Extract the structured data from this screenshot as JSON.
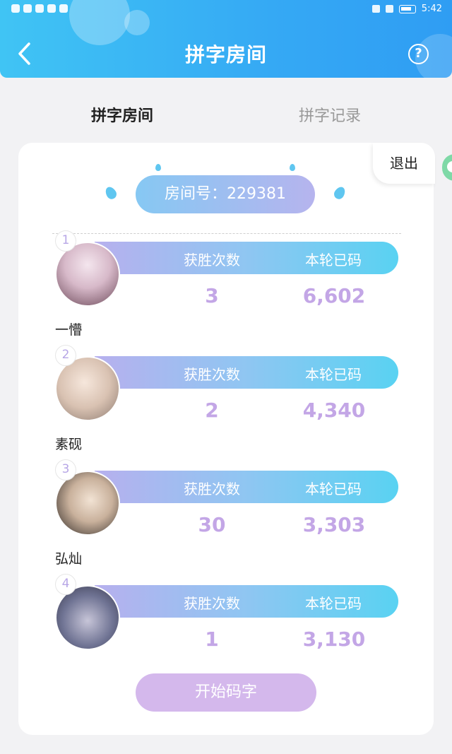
{
  "status_bar": {
    "time": "5:42"
  },
  "header": {
    "title": "拼字房间",
    "back_icon": "chevron-left-icon",
    "help_icon": "question-circle-icon",
    "help_glyph": "?"
  },
  "tabs": [
    {
      "label": "拼字房间",
      "active": true
    },
    {
      "label": "拼字记录",
      "active": false
    }
  ],
  "exit_label": "退出",
  "room": {
    "label": "房间号：229381"
  },
  "columns": {
    "wins": "获胜次数",
    "count": "本轮已码"
  },
  "players": [
    {
      "rank": "1",
      "name": "一懵",
      "wins": "3",
      "count": "6,602"
    },
    {
      "rank": "2",
      "name": "素砚",
      "wins": "2",
      "count": "4,340"
    },
    {
      "rank": "3",
      "name": "弘灿",
      "wins": "30",
      "count": "3,303"
    },
    {
      "rank": "4",
      "name": "",
      "wins": "1",
      "count": "3,130"
    }
  ],
  "start_button": "开始码字",
  "colors": {
    "header_start": "#40c4f4",
    "header_end": "#2f9df3",
    "stat_purple": "#c3a6e6",
    "start_button": "#d4b8ec"
  }
}
